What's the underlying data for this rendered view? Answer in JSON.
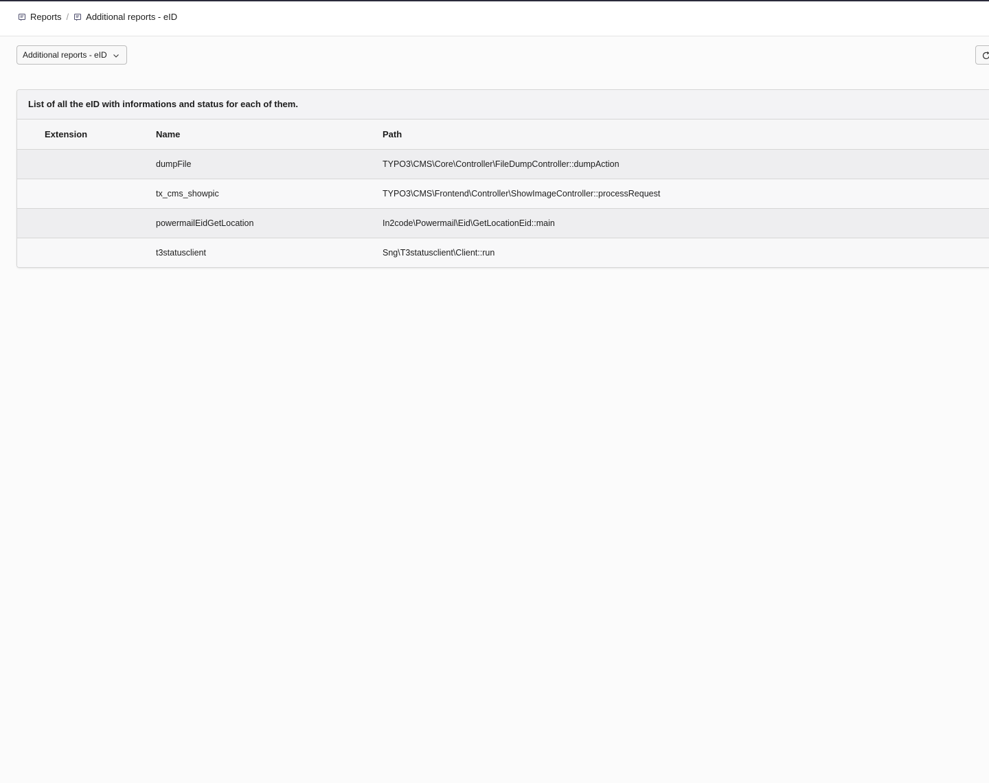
{
  "breadcrumb": {
    "items": [
      {
        "label": "Reports",
        "icon": "report-icon"
      },
      {
        "label": "Additional reports - eID",
        "icon": "report-icon"
      }
    ],
    "separator": "/"
  },
  "toolbar": {
    "report_select": {
      "selected": "Additional reports - eID",
      "icon": "chevron-down-icon"
    },
    "refresh_icon": "refresh-icon"
  },
  "panel": {
    "heading": "List of all the eID with informations and status for each of them.",
    "columns": {
      "extension": "Extension",
      "name": "Name",
      "path": "Path"
    },
    "rows": [
      {
        "extension": "",
        "name": "dumpFile",
        "path": "TYPO3\\CMS\\Core\\Controller\\FileDumpController::dumpAction"
      },
      {
        "extension": "",
        "name": "tx_cms_showpic",
        "path": "TYPO3\\CMS\\Frontend\\Controller\\ShowImageController::processRequest"
      },
      {
        "extension": "",
        "name": "powermailEidGetLocation",
        "path": "In2code\\Powermail\\Eid\\GetLocationEid::main"
      },
      {
        "extension": "",
        "name": "t3statusclient",
        "path": "Sng\\T3statusclient\\Client::run"
      }
    ]
  },
  "colors": {
    "header_bg": "#ffffff",
    "page_bg": "#fbfbfb",
    "panel_heading_bg": "#f3f3f5",
    "row_odd_bg": "#eeeef0",
    "row_even_bg": "#f8f8f9",
    "border": "#d6d6d6"
  }
}
